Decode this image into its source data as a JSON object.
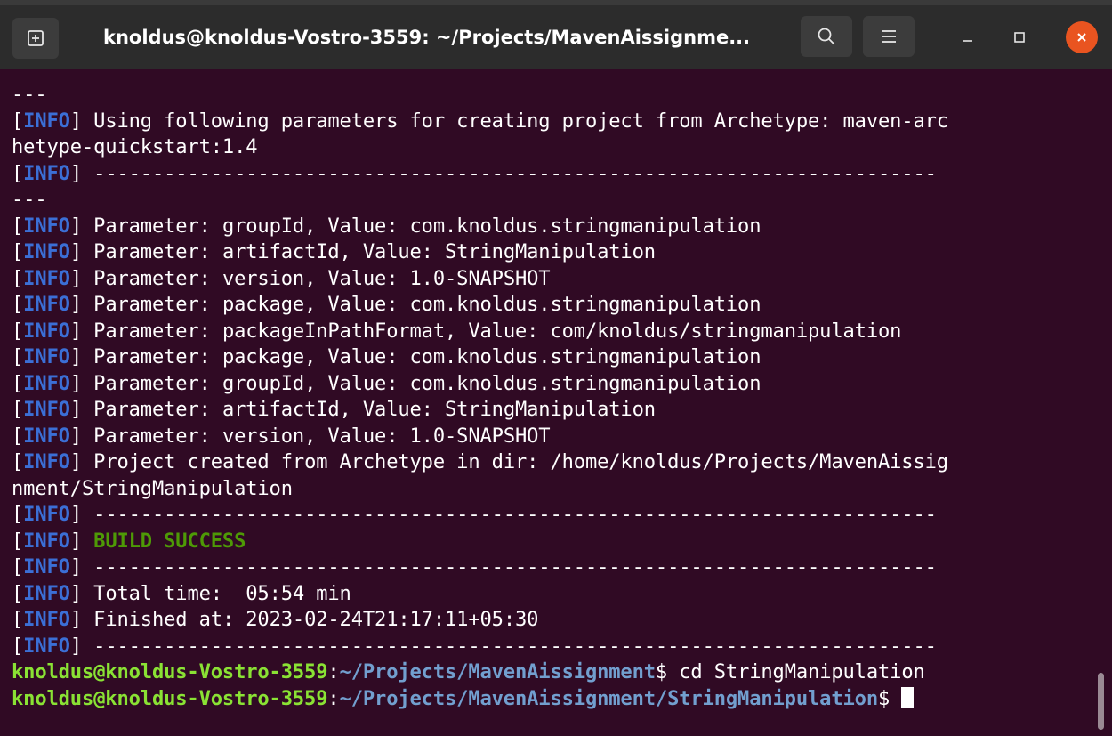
{
  "window": {
    "title": "knoldus@knoldus-Vostro-3559: ~/Projects/MavenAissignme...",
    "icons": [
      "new-tab-icon",
      "search-icon",
      "hamburger-menu-icon",
      "minimize-icon",
      "maximize-icon",
      "close-icon"
    ],
    "colors": {
      "titlebar": "#2c2c2c",
      "background": "#300a24",
      "close": "#e95420",
      "info": "#3b6fd6",
      "success": "#4e9a06",
      "prompt_user": "#8ae234",
      "prompt_path": "#729fcf"
    }
  },
  "terminal": {
    "lines": [
      {
        "type": "plain",
        "text": "---"
      },
      {
        "type": "info",
        "tag": "INFO",
        "text": " Using following parameters for creating project from Archetype: maven-arc"
      },
      {
        "type": "plain",
        "text": "hetype-quickstart:1.4"
      },
      {
        "type": "info",
        "tag": "INFO",
        "text": " ------------------------------------------------------------------------"
      },
      {
        "type": "plain",
        "text": "---"
      },
      {
        "type": "info",
        "tag": "INFO",
        "text": " Parameter: groupId, Value: com.knoldus.stringmanipulation"
      },
      {
        "type": "info",
        "tag": "INFO",
        "text": " Parameter: artifactId, Value: StringManipulation"
      },
      {
        "type": "info",
        "tag": "INFO",
        "text": " Parameter: version, Value: 1.0-SNAPSHOT"
      },
      {
        "type": "info",
        "tag": "INFO",
        "text": " Parameter: package, Value: com.knoldus.stringmanipulation"
      },
      {
        "type": "info",
        "tag": "INFO",
        "text": " Parameter: packageInPathFormat, Value: com/knoldus/stringmanipulation"
      },
      {
        "type": "info",
        "tag": "INFO",
        "text": " Parameter: package, Value: com.knoldus.stringmanipulation"
      },
      {
        "type": "info",
        "tag": "INFO",
        "text": " Parameter: groupId, Value: com.knoldus.stringmanipulation"
      },
      {
        "type": "info",
        "tag": "INFO",
        "text": " Parameter: artifactId, Value: StringManipulation"
      },
      {
        "type": "info",
        "tag": "INFO",
        "text": " Parameter: version, Value: 1.0-SNAPSHOT"
      },
      {
        "type": "info",
        "tag": "INFO",
        "text": " Project created from Archetype in dir: /home/knoldus/Projects/MavenAissig"
      },
      {
        "type": "plain",
        "text": "nment/StringManipulation"
      },
      {
        "type": "info",
        "tag": "INFO",
        "text": " ------------------------------------------------------------------------"
      },
      {
        "type": "success",
        "tag": "INFO",
        "text": "BUILD SUCCESS"
      },
      {
        "type": "info",
        "tag": "INFO",
        "text": " ------------------------------------------------------------------------"
      },
      {
        "type": "info",
        "tag": "INFO",
        "text": " Total time:  05:54 min"
      },
      {
        "type": "info",
        "tag": "INFO",
        "text": " Finished at: 2023-02-24T21:17:11+05:30"
      },
      {
        "type": "info",
        "tag": "INFO",
        "text": " ------------------------------------------------------------------------"
      },
      {
        "type": "prompt",
        "user": "knoldus@knoldus-Vostro-3559",
        "path": "~/Projects/MavenAissignment",
        "command": " cd StringManipulation"
      },
      {
        "type": "prompt",
        "user": "knoldus@knoldus-Vostro-3559",
        "path": "~/Projects/MavenAissignment/StringManipulation",
        "command": " ",
        "cursor": true
      }
    ]
  }
}
